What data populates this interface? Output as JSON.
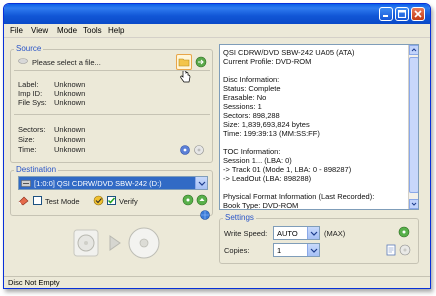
{
  "menu": [
    "File",
    "View",
    "Mode",
    "Tools",
    "Help"
  ],
  "source": {
    "title": "Source",
    "placeholder": "Please select a file...",
    "fields": [
      {
        "label": "Label:",
        "value": "Unknown"
      },
      {
        "label": "Imp ID:",
        "value": "Unknown"
      },
      {
        "label": "File Sys:",
        "value": "Unknown"
      },
      {
        "label": "Sectors:",
        "value": "Unknown"
      },
      {
        "label": "Size:",
        "value": "Unknown"
      },
      {
        "label": "Time:",
        "value": "Unknown"
      }
    ]
  },
  "destination": {
    "title": "Destination",
    "drive": "[1:0:0] QSI CDRW/DVD SBW-242 (D:)",
    "test_mode_label": "Test Mode",
    "verify_label": "Verify",
    "verify_checked": true,
    "test_mode_checked": false
  },
  "info": {
    "lines": [
      "QSI CDRW/DVD SBW-242 UA05 (ATA)",
      "Current Profile: DVD-ROM",
      "",
      "Disc Information:",
      "Status: Complete",
      "Erasable: No",
      "Sessions: 1",
      "Sectors: 898,288",
      "Size: 1,839,693,824 bytes",
      "Time: 199:39:13 (MM:SS:FF)",
      "",
      "TOC Information:",
      "Session 1... (LBA: 0)",
      "-> Track 01  (Mode 1, LBA: 0 - 898287)",
      "-> LeadOut  (LBA: 898288)",
      "",
      "Physical Format Information (Last Recorded):",
      "Book Type: DVD-ROM"
    ]
  },
  "settings": {
    "title": "Settings",
    "write_speed_label": "Write Speed:",
    "write_speed_value": "AUTO",
    "write_speed_max": "(MAX)",
    "copies_label": "Copies:",
    "copies_value": "1"
  },
  "status": {
    "text": "Disc Not Empty"
  },
  "colors": {
    "titlebar": "#0a5fe8",
    "window_bg": "#ece9d8",
    "group_title": "#2a55c8",
    "selection": "#316ac5"
  }
}
